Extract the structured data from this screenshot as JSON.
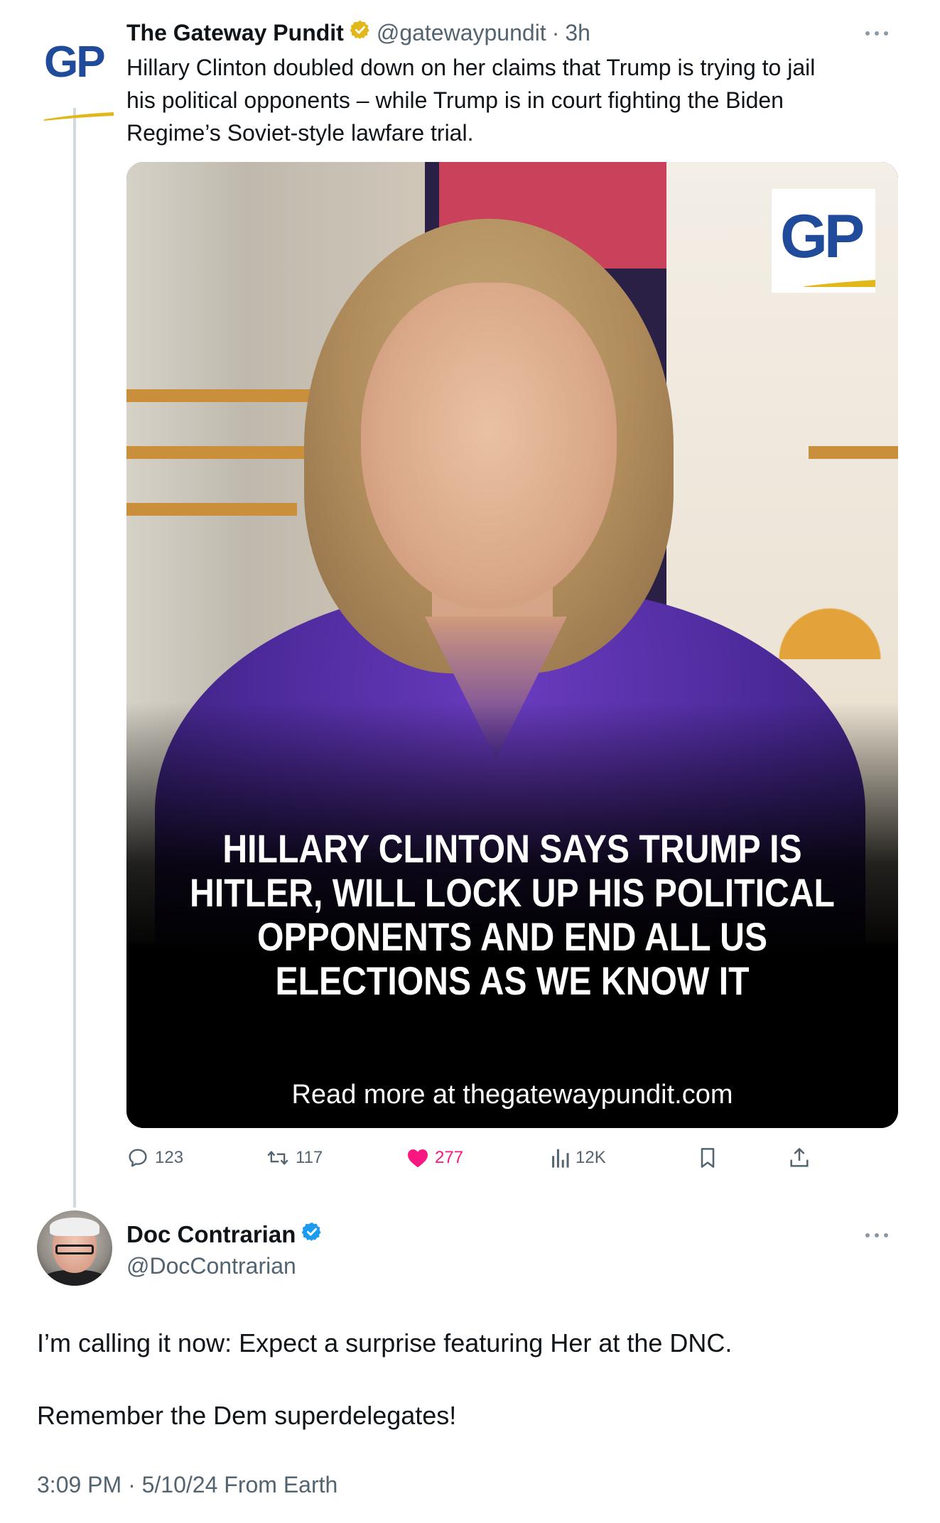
{
  "parent_tweet": {
    "display_name": "The Gateway Pundit",
    "handle": "@gatewaypundit",
    "separator": "·",
    "age": "3h",
    "avatar_text": "GP",
    "verified_color": "#e2b719",
    "text_lines": [
      "Hillary Clinton doubled down on her claims that Trump is trying to jail",
      "his political opponents – while Trump is in court fighting the Biden",
      "Regime’s Soviet-style lawfare trial."
    ],
    "media": {
      "badge_text": "GP",
      "headline_lines": [
        "HILLARY CLINTON SAYS TRUMP IS",
        "HITLER, WILL LOCK UP HIS POLITICAL",
        "OPPONENTS AND END ALL US",
        "ELECTIONS AS WE KNOW IT"
      ],
      "read_more": "Read more at thegatewaypundit.com"
    },
    "actions": {
      "replies": "123",
      "reposts": "117",
      "likes": "277",
      "views": "12K"
    },
    "like_color": "#f91880"
  },
  "reply_tweet": {
    "display_name": "Doc Contrarian",
    "handle": "@DocContrarian",
    "verified_color": "#1d9bf0",
    "text_paragraphs": [
      "I’m calling it now: Expect a surprise featuring Her at the DNC.",
      "Remember the Dem superdelegates!"
    ],
    "timestamp": "3:09 PM · 5/10/24 From Earth"
  },
  "icons": {
    "verified_gold": "verified-badge-gold-icon",
    "verified_blue": "verified-badge-blue-icon",
    "more": "more-dots-icon",
    "reply": "reply-bubble-icon",
    "repost": "repost-icon",
    "like": "heart-icon",
    "views": "views-bars-icon",
    "bookmark": "bookmark-icon",
    "share": "share-icon"
  }
}
